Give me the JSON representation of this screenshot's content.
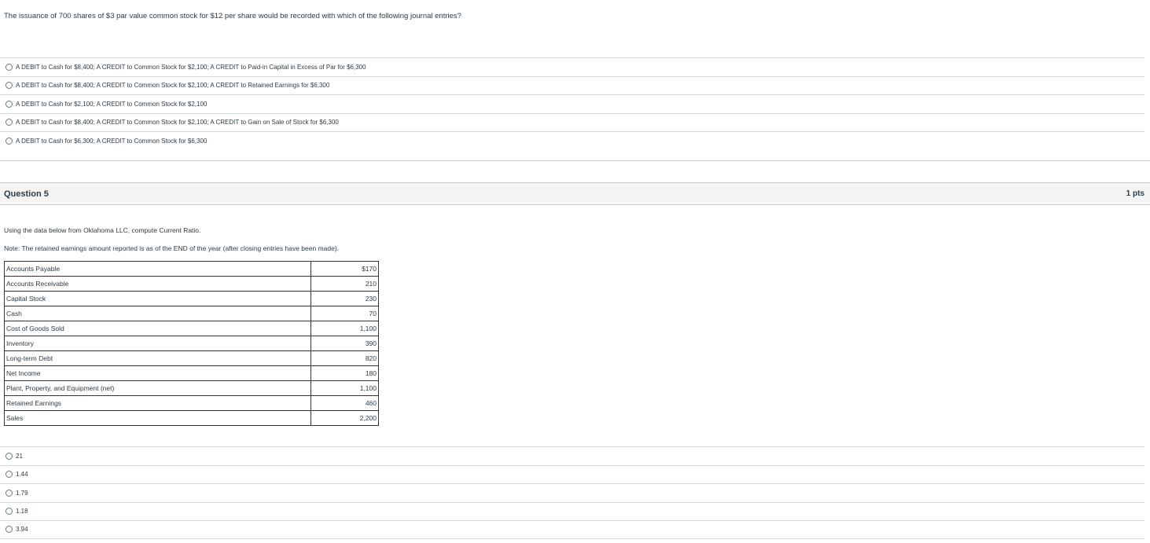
{
  "question4": {
    "text": "The issuance of 700 shares of $3 par value common stock for $12 per share would be recorded with which of the following journal entries?",
    "answers": [
      "A DEBIT to Cash for $8,400; A CREDIT to Common Stock for $2,100; A CREDIT to Paid-in Capital in Excess of Par for $6,300",
      "A DEBIT to Cash for $8,400; A CREDIT to Common Stock for $2,100; A CREDIT to Retained Earnings for $6,300",
      "A DEBIT to Cash for $2,100; A CREDIT to Common Stock for $2,100",
      "A DEBIT to Cash for $8,400; A CREDIT to Common Stock for $2,100; A CREDIT to Gain on Sale of Stock for $6,300",
      "A DEBIT to Cash for $6,300; A CREDIT to Common Stock for $6,300"
    ]
  },
  "question5": {
    "title": "Question 5",
    "points": "1 pts",
    "prompt": "Using the data below from Oklahoma LLC, compute Current Ratio.",
    "note": "Note: The retained earnings amount reported is as of the END of the year (after closing entries have been made).",
    "table": [
      {
        "label": "Accounts Payable",
        "value": "$170"
      },
      {
        "label": "Accounts Receivable",
        "value": "210"
      },
      {
        "label": "Capital Stock",
        "value": "230"
      },
      {
        "label": "Cash",
        "value": "70"
      },
      {
        "label": "Cost of Goods Sold",
        "value": "1,100"
      },
      {
        "label": "Inventory",
        "value": "390"
      },
      {
        "label": "Long-term Debt",
        "value": "820"
      },
      {
        "label": "Net Income",
        "value": "180"
      },
      {
        "label": "Plant, Property, and Equipment (net)",
        "value": "1,100"
      },
      {
        "label": "Retained Earnings",
        "value": "460"
      },
      {
        "label": "Sales",
        "value": "2,200"
      }
    ],
    "answers": [
      "21",
      "1.44",
      "1.79",
      "1.18",
      "3.94"
    ]
  }
}
